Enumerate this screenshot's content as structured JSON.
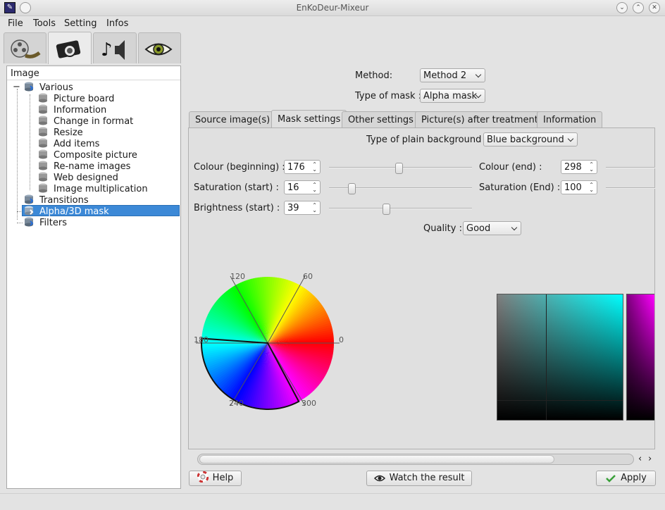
{
  "window": {
    "title": "EnKoDeur-Mixeur"
  },
  "menu": {
    "file": "File",
    "tools": "Tools",
    "setting": "Setting",
    "infos": "Infos"
  },
  "main_tabs": [
    {
      "icon": "film-reel-icon",
      "active": false
    },
    {
      "icon": "camera-icon",
      "active": true
    },
    {
      "icon": "music-speaker-icon",
      "active": false
    },
    {
      "icon": "eye-icon",
      "active": false
    }
  ],
  "sidebar": {
    "header": "Image",
    "items": [
      {
        "label": "Various",
        "level": 1
      },
      {
        "label": "Picture board",
        "level": 2
      },
      {
        "label": "Information",
        "level": 2
      },
      {
        "label": "Change in format",
        "level": 2
      },
      {
        "label": "Resize",
        "level": 2
      },
      {
        "label": "Add items",
        "level": 2
      },
      {
        "label": "Composite picture",
        "level": 2
      },
      {
        "label": "Re-name images",
        "level": 2
      },
      {
        "label": "Web designed",
        "level": 2
      },
      {
        "label": "Image multiplication",
        "level": 2
      },
      {
        "label": "Transitions",
        "level": 1
      },
      {
        "label": "Alpha/3D mask",
        "level": 1,
        "selected": true
      },
      {
        "label": "Filters",
        "level": 1
      }
    ]
  },
  "method": {
    "label": "Method:",
    "value": "Method 2"
  },
  "mask_type": {
    "label": "Type of mask :",
    "value": "Alpha mask"
  },
  "tabs": [
    {
      "label": "Source image(s)"
    },
    {
      "label": "Mask settings",
      "active": true
    },
    {
      "label": "Other settings"
    },
    {
      "label": "Picture(s) after treatment"
    },
    {
      "label": "Information"
    }
  ],
  "mask_settings": {
    "background": {
      "label": "Type of plain background :",
      "value": "Blue background"
    },
    "colour_begin": {
      "label": "Colour (beginning) :",
      "value": "176",
      "slider_fraction": 0.49
    },
    "colour_end": {
      "label": "Colour (end) :",
      "value": "298"
    },
    "sat_start": {
      "label": "Saturation (start) :",
      "value": "16",
      "slider_fraction": 0.16
    },
    "sat_end": {
      "label": "Saturation (End) :",
      "value": "100"
    },
    "brightness": {
      "label": "Brightness (start) :",
      "value": "39",
      "slider_fraction": 0.4
    },
    "quality": {
      "label": "Quality :",
      "value": "Good"
    }
  },
  "hue_wheel": {
    "ticks": [
      "120",
      "60",
      "0",
      "180",
      "240",
      "300"
    ],
    "selection_start": 176,
    "selection_end": 298
  },
  "buttons": {
    "help": "Help",
    "watch": "Watch the result",
    "apply": "Apply"
  },
  "colors": {
    "selection": "#3c89d7",
    "accent_green": "#3aa03a"
  }
}
